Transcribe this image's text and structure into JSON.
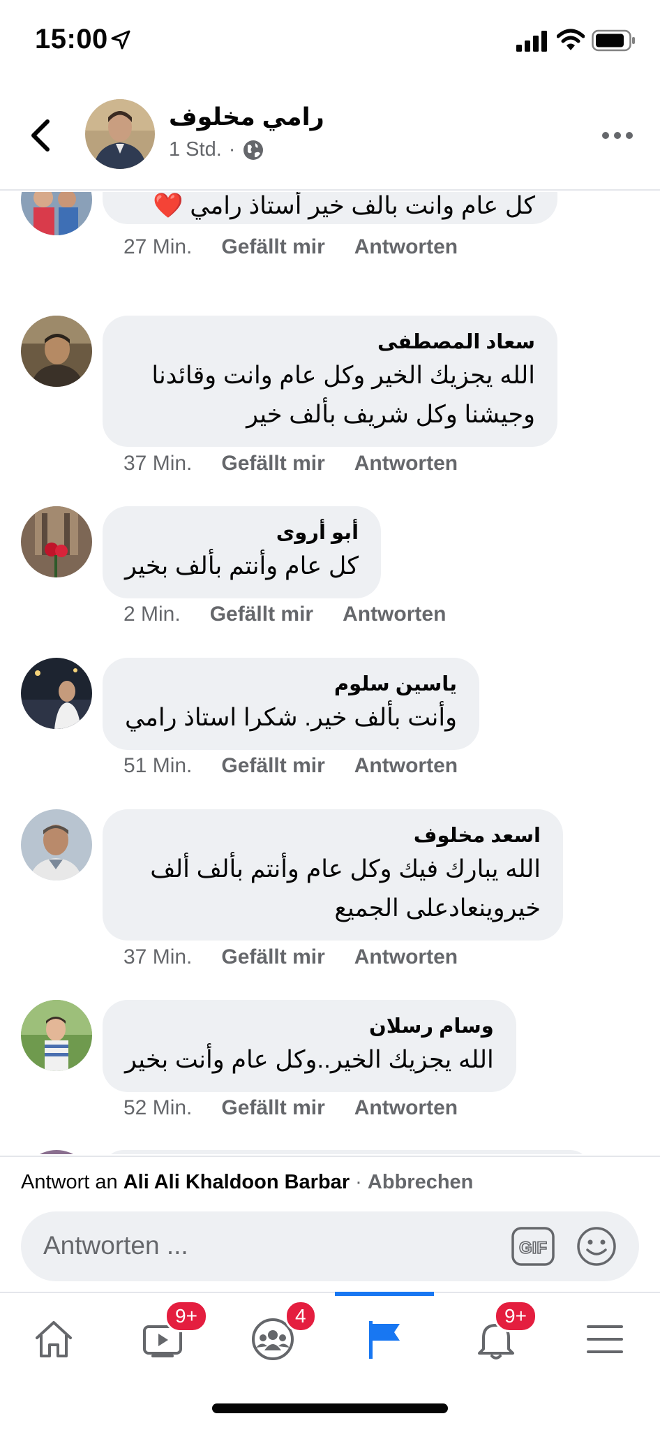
{
  "status_bar": {
    "time": "15:00"
  },
  "header": {
    "name": "رامي مخلوف",
    "time": "1 Std.",
    "separator": "·"
  },
  "comments": [
    {
      "name": "",
      "text": "كل عام وانت بالف خير أستاذ رامي ❤️",
      "time": "27 Min.",
      "like": "Gefällt mir",
      "reply": "Antworten"
    },
    {
      "name": "سعاد المصطفى",
      "text": "الله يجزيك الخير وكل عام وانت وقائدنا وجيشنا وكل شريف بألف خير",
      "time": "37 Min.",
      "like": "Gefällt mir",
      "reply": "Antworten"
    },
    {
      "name": "أبو أروى",
      "text": "كل عام وأنتم بألف بخير",
      "time": "2 Min.",
      "like": "Gefällt mir",
      "reply": "Antworten"
    },
    {
      "name": "ياسين سلوم",
      "text": "وأنت بألف خير. شكرا استاذ رامي",
      "time": "51 Min.",
      "like": "Gefällt mir",
      "reply": "Antworten"
    },
    {
      "name": "اسعد مخلوف",
      "text": "الله يبارك فيك وكل عام وأنتم بألف ألف خيروينعادعلى الجميع",
      "time": "37 Min.",
      "like": "Gefällt mir",
      "reply": "Antworten"
    },
    {
      "name": "وسام رسلان",
      "text": "الله يجزيك الخير..وكل عام وأنت بخير",
      "time": "52 Min.",
      "like": "Gefällt mir",
      "reply": "Antworten"
    }
  ],
  "reply_bar": {
    "prefix": "Antwort an",
    "target": "Ali Ali Khaldoon Barbar",
    "separator": "·",
    "cancel": "Abbrechen",
    "placeholder": "Antworten ...",
    "gif": "GIF"
  },
  "tabbar": {
    "badges": {
      "watch": "9+",
      "groups": "4",
      "notifications": "9+"
    }
  },
  "colors": {
    "accent": "#1877f2",
    "badge": "#e41e3f",
    "muted": "#65676b",
    "bubble": "#eef0f3"
  }
}
